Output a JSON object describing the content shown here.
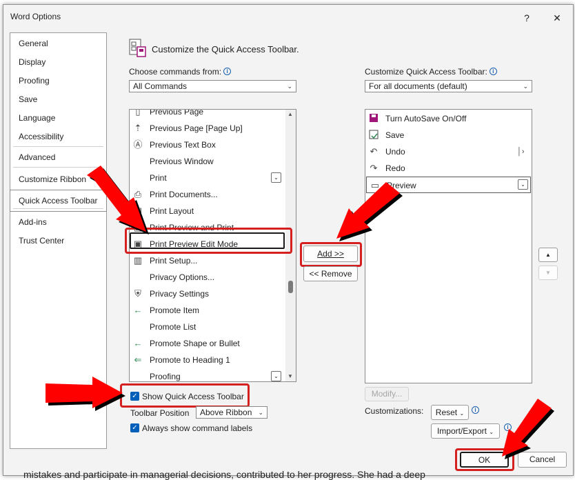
{
  "window": {
    "title": "Word Options",
    "help_glyph": "?",
    "close_glyph": "✕"
  },
  "nav": {
    "items": [
      {
        "label": "General"
      },
      {
        "label": "Display"
      },
      {
        "label": "Proofing"
      },
      {
        "label": "Save"
      },
      {
        "label": "Language"
      },
      {
        "label": "Accessibility"
      },
      {
        "label": "Advanced"
      },
      {
        "label": "Customize Ribbon"
      },
      {
        "label": "Quick Access Toolbar",
        "selected": true
      },
      {
        "label": "Add-ins"
      },
      {
        "label": "Trust Center"
      }
    ]
  },
  "header": {
    "title": "Customize the Quick Access Toolbar."
  },
  "commands": {
    "label": "Choose commands from:",
    "selected": "All Commands",
    "items": [
      {
        "label": "Previous Page",
        "icon": "page-icon"
      },
      {
        "label": "Previous Page [Page Up]",
        "icon": "page-up-icon"
      },
      {
        "label": "Previous Text Box",
        "icon": "text-box-icon"
      },
      {
        "label": "Previous Window",
        "icon": ""
      },
      {
        "label": "Print",
        "icon": "",
        "expand": true
      },
      {
        "label": "Print Documents...",
        "icon": "printer-icon"
      },
      {
        "label": "Print Layout",
        "icon": "print-layout-icon"
      },
      {
        "label": "Print Preview and Print",
        "icon": "print-preview-icon"
      },
      {
        "label": "Print Preview Edit Mode",
        "icon": "print-preview-edit-icon",
        "selected": true
      },
      {
        "label": "Print Setup...",
        "icon": "print-setup-icon"
      },
      {
        "label": "Privacy Options...",
        "icon": ""
      },
      {
        "label": "Privacy Settings",
        "icon": "privacy-icon"
      },
      {
        "label": "Promote Item",
        "icon": "arrow-left-icon"
      },
      {
        "label": "Promote List",
        "icon": ""
      },
      {
        "label": "Promote Shape or Bullet",
        "icon": "arrow-left-icon"
      },
      {
        "label": "Promote to Heading 1",
        "icon": "double-arrow-left-icon"
      },
      {
        "label": "Proofing",
        "icon": "",
        "expand": true
      }
    ]
  },
  "toolbar_list": {
    "label": "Customize Quick Access Toolbar:",
    "selected": "For all documents (default)",
    "items": [
      {
        "label": "Turn AutoSave On/Off",
        "icon": "autosave-icon"
      },
      {
        "label": "Save",
        "icon": "save-icon"
      },
      {
        "label": "Undo",
        "icon": "undo-icon"
      },
      {
        "label": "Redo",
        "icon": "redo-icon"
      },
      {
        "label": "Preview",
        "icon": "preview-icon",
        "expand": true
      }
    ]
  },
  "buttons": {
    "add": "Add >>",
    "remove": "<< Remove",
    "modify": "Modify...",
    "reset": "Reset",
    "import_export": "Import/Export",
    "ok": "OK",
    "cancel": "Cancel"
  },
  "options": {
    "show_qat_label": "Show Quick Access Toolbar",
    "show_qat_checked": true,
    "toolbar_position_label": "Toolbar Position",
    "toolbar_position_value": "Above Ribbon",
    "always_show_labels_label": "Always show command labels",
    "always_show_labels_checked": true,
    "customizations_label": "Customizations:"
  },
  "background_text": "mistakes and participate in managerial decisions, contributed to her progress. She had a deep",
  "colors": {
    "highlight_red": "#d42020",
    "accent_blue": "#005fb8",
    "arrow_red": "#ff0000"
  }
}
